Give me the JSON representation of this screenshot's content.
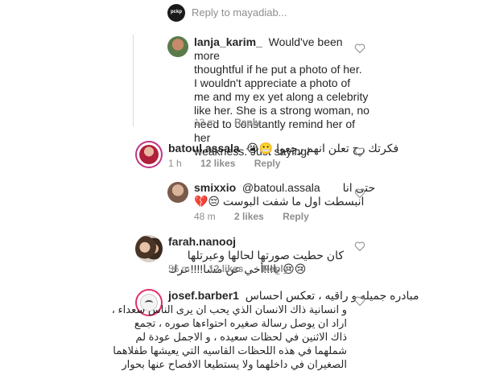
{
  "reply_prompt": {
    "avatar_label": "pckp",
    "placeholder": "Reply to mayadiab..."
  },
  "comments": [
    {
      "username": "lanja_karim_",
      "text_lines": [
        "Would've been more",
        "thoughtful if he put a photo of her.",
        "I wouldn't appreciate a photo of",
        "me and my ex yet along a celebrity",
        "like her. She is a strong woman, no",
        "need to constantly remind her of her",
        "weakness. Just saying!"
      ],
      "time": "13 m",
      "reply": "Reply"
    },
    {
      "username": "batoul.assala",
      "text": "فكرتك رح تعلن انهم رجعوا 😬😭",
      "time": "1 h",
      "likes": "12 likes",
      "reply": "Reply"
    },
    {
      "username": "smixxio",
      "mention": "@batoul.assala",
      "text_prefix": "حتى انا",
      "text_line2": "انبسطت اول ما شفت البوست 😔💔",
      "time": "48 m",
      "likes": "2 likes",
      "reply": "Reply"
    },
    {
      "username": "farah.nanooj",
      "text_line1": "كان حطيت صورتها لحالها وعبرتلها",
      "text_line2": "😢😢 يا!!!أخي عن مشا!!!!عرك",
      "time": "56 m",
      "likes": "12 likes",
      "reply": "Reply"
    },
    {
      "username": "josef.barber1",
      "first_line": "مبادره جميله و راقيه ، تعكس احساس",
      "text_lines": [
        "و انسانية ذاك الانسان الذي يحب ان يرى الناس سعداء ،",
        "اراد ان يوصل رسالة صغيره احتواءها صوره ، تجمع",
        "ذاك الاثنين في لحظات سعيده ، و الاجمل عودة لم",
        "شملهما في هذه اللحظات  القاسيه التي يعيشها طفلاهما",
        "الصغيران في داخلهما ولا يستطيعا الافصاح عنها بحوار"
      ]
    }
  ],
  "colors": {
    "text": "#262626",
    "meta": "#8e8e8e",
    "line": "#dbdbdb",
    "heart": "#8e8e8e"
  }
}
